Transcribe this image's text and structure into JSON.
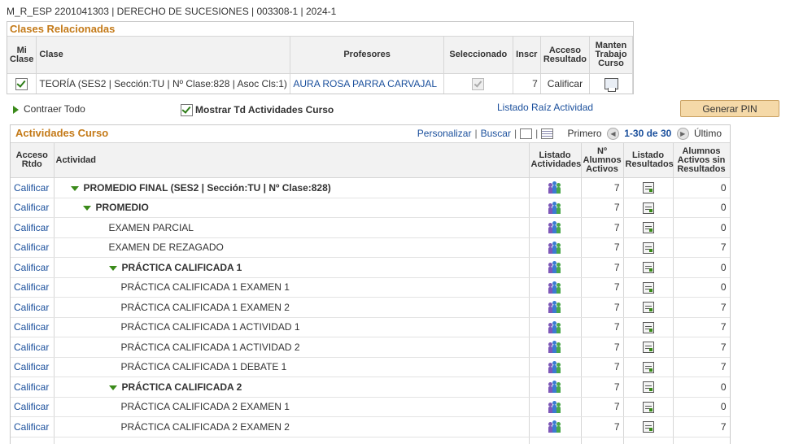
{
  "header": {
    "text": "M_R_ESP 2201041303 | DERECHO DE SUCESIONES | 003308-1 | 2024-1"
  },
  "clases": {
    "title": "Clases Relacionadas",
    "columns": {
      "mi_clase": "Mi Clase",
      "clase": "Clase",
      "profesores": "Profesores",
      "seleccionado": "Seleccionado",
      "inscr": "Inscr",
      "acceso": "Acceso Resultado",
      "manten": "Manten Trabajo Curso"
    },
    "row": {
      "clase": "TEORÍA (SES2 | Sección:TU | Nº Clase:828 | Asoc Cls:1)",
      "profesor": "AURA ROSA PARRA CARVAJAL",
      "inscr": "7",
      "acceso": "Calificar"
    }
  },
  "controls": {
    "contraer": "Contraer Todo",
    "mostrar": "Mostrar Td Actividades Curso",
    "listado_raiz": "Listado Raíz Actividad",
    "generar_pin": "Generar PIN"
  },
  "actividades": {
    "title": "Actividades Curso",
    "nav": {
      "personalizar": "Personalizar",
      "buscar": "Buscar",
      "primero": "Primero",
      "range": "1-30 de 30",
      "ultimo": "Último"
    },
    "columns": {
      "acceso": "Acceso Rtdo",
      "actividad": "Actividad",
      "listado_act": "Listado Actividades",
      "num_alumnos": "Nº Alumnos Activos",
      "listado_res": "Listado Resultados",
      "sin_res": "Alumnos Activos sin Resultados"
    },
    "rows": [
      {
        "acceso": "Calificar",
        "actividad": "PROMEDIO FINAL (SES2 | Sección:TU | Nº Clase:828)",
        "level": 0,
        "expandable": true,
        "alumnos": "7",
        "sin_res": "0"
      },
      {
        "acceso": "Calificar",
        "actividad": "PROMEDIO",
        "level": 1,
        "expandable": true,
        "alumnos": "7",
        "sin_res": "0"
      },
      {
        "acceso": "Calificar",
        "actividad": "EXAMEN PARCIAL",
        "level": 2,
        "expandable": false,
        "alumnos": "7",
        "sin_res": "0"
      },
      {
        "acceso": "Calificar",
        "actividad": "EXAMEN DE REZAGADO",
        "level": 2,
        "expandable": false,
        "alumnos": "7",
        "sin_res": "7"
      },
      {
        "acceso": "Calificar",
        "actividad": "PRÁCTICA CALIFICADA 1",
        "level": 2,
        "expandable": true,
        "alumnos": "7",
        "sin_res": "0"
      },
      {
        "acceso": "Calificar",
        "actividad": "PRÁCTICA CALIFICADA 1 EXAMEN 1",
        "level": 3,
        "expandable": false,
        "alumnos": "7",
        "sin_res": "0"
      },
      {
        "acceso": "Calificar",
        "actividad": "PRÁCTICA CALIFICADA 1 EXAMEN 2",
        "level": 3,
        "expandable": false,
        "alumnos": "7",
        "sin_res": "7"
      },
      {
        "acceso": "Calificar",
        "actividad": "PRÁCTICA CALIFICADA 1 ACTIVIDAD 1",
        "level": 3,
        "expandable": false,
        "alumnos": "7",
        "sin_res": "7"
      },
      {
        "acceso": "Calificar",
        "actividad": "PRÁCTICA CALIFICADA 1 ACTIVIDAD 2",
        "level": 3,
        "expandable": false,
        "alumnos": "7",
        "sin_res": "7"
      },
      {
        "acceso": "Calificar",
        "actividad": "PRÁCTICA CALIFICADA 1 DEBATE 1",
        "level": 3,
        "expandable": false,
        "alumnos": "7",
        "sin_res": "7"
      },
      {
        "acceso": "Calificar",
        "actividad": "PRÁCTICA CALIFICADA 2",
        "level": 2,
        "expandable": true,
        "alumnos": "7",
        "sin_res": "0"
      },
      {
        "acceso": "Calificar",
        "actividad": "PRÁCTICA CALIFICADA 2 EXAMEN 1",
        "level": 3,
        "expandable": false,
        "alumnos": "7",
        "sin_res": "0"
      },
      {
        "acceso": "Calificar",
        "actividad": "PRÁCTICA CALIFICADA 2 EXAMEN 2",
        "level": 3,
        "expandable": false,
        "alumnos": "7",
        "sin_res": "7"
      },
      {
        "acceso": "",
        "actividad": "",
        "level": 3,
        "expandable": false,
        "alumnos": "",
        "sin_res": ""
      }
    ]
  },
  "colors": {
    "section_title": "#c47a18",
    "link": "#1a4f9c",
    "expander": "#3a8a1a",
    "button_bg": "#f5d9a8"
  }
}
